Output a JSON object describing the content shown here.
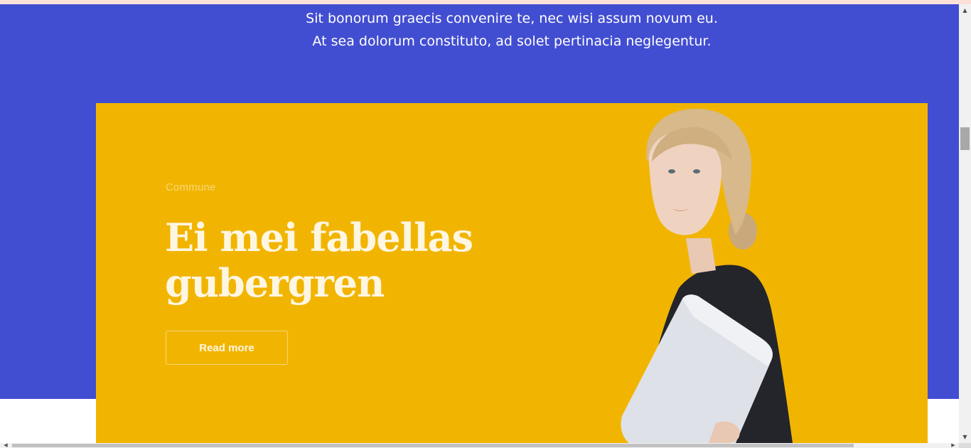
{
  "intro": {
    "line1": "Sit bonorum graecis convenire te, nec wisi assum novum eu.",
    "line2": "At sea dolorum constituto, ad solet pertinacia neglegentur."
  },
  "hero": {
    "eyebrow": "Commune",
    "headline_line1": "Ei mei fabellas",
    "headline_line2": "gubergren",
    "button_label": "Read more",
    "image": "woman-holding-laptop"
  },
  "colors": {
    "top_strip": "#fbe1d9",
    "band": "#424ed1",
    "card": "#f1b501",
    "text_light": "#fff6e2",
    "eyebrow": "#f7d776"
  },
  "scrollbars": {
    "vertical_up_icon": "triangle-up",
    "vertical_down_icon": "triangle-down",
    "horizontal_left_icon": "triangle-left",
    "horizontal_right_icon": "triangle-right"
  }
}
